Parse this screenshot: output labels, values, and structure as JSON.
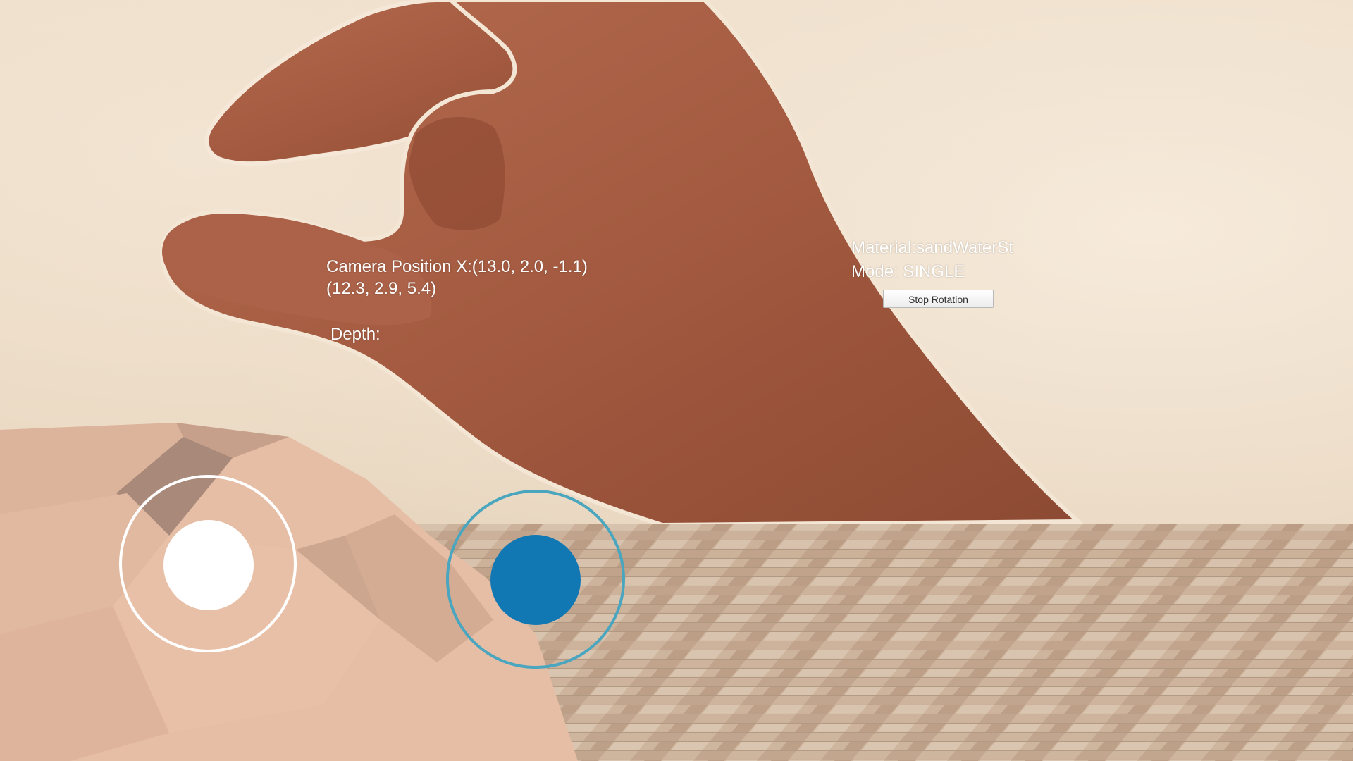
{
  "hud": {
    "camera_position_line1": "Camera Position X:(13.0, 2.0, -1.1)",
    "camera_position_line2": "(12.3, 2.9, 5.4)",
    "depth_label": "Depth:",
    "material_label": "Material:sandWaterSt",
    "mode_label": "Mode: SINGLE",
    "stop_rotation_button": "Stop Rotation"
  },
  "colors": {
    "hud_text": "#ffffff",
    "left_joystick": "#ffffff",
    "right_joystick_ring": "#4aa6bf",
    "right_joystick_knob": "#1278b4"
  },
  "icons": {
    "left_joystick": "joystick-icon",
    "right_joystick": "joystick-icon"
  }
}
